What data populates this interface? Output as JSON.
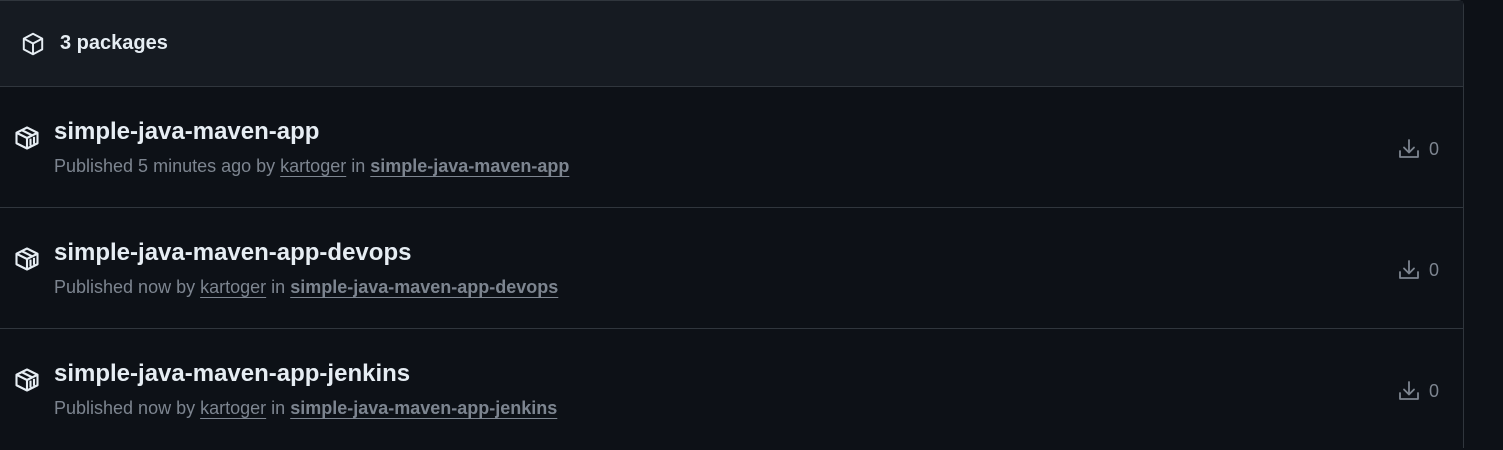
{
  "header": {
    "icon": "package-icon",
    "count_label": "3 packages"
  },
  "packages": [
    {
      "name": "simple-java-maven-app",
      "published_prefix": "Published 5 minutes ago by",
      "user": "kartoger",
      "in_label": "in",
      "repo": "simple-java-maven-app",
      "downloads": "0",
      "icon": "container-icon"
    },
    {
      "name": "simple-java-maven-app-devops",
      "published_prefix": "Published now by",
      "user": "kartoger",
      "in_label": "in",
      "repo": "simple-java-maven-app-devops",
      "downloads": "0",
      "icon": "container-icon"
    },
    {
      "name": "simple-java-maven-app-jenkins",
      "published_prefix": "Published now by",
      "user": "kartoger",
      "in_label": "in",
      "repo": "simple-java-maven-app-jenkins",
      "downloads": "0",
      "icon": "container-icon"
    }
  ],
  "colors": {
    "background": "#0d1117",
    "header_background": "#161b22",
    "border": "#30363d",
    "text_primary": "#e6edf3",
    "text_muted": "#7d8590"
  }
}
